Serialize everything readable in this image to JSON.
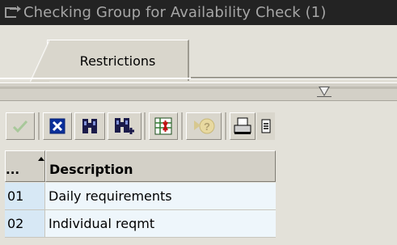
{
  "window": {
    "title": "Checking Group for Availability Check (1)"
  },
  "tabs": [
    {
      "label": "Restrictions",
      "active": true
    }
  ],
  "toolbar": {
    "buttons": [
      {
        "name": "check-icon",
        "enabled": false
      },
      {
        "name": "delete-icon",
        "enabled": true
      },
      {
        "name": "find-icon",
        "enabled": true
      },
      {
        "name": "find-next-icon",
        "enabled": true
      },
      {
        "name": "new-entries-icon",
        "enabled": true
      },
      {
        "name": "help-icon",
        "enabled": false
      },
      {
        "name": "print-icon",
        "enabled": true
      },
      {
        "name": "details-icon",
        "enabled": true
      }
    ]
  },
  "table": {
    "headers": {
      "select": "...",
      "description": "Description"
    },
    "rows": [
      {
        "key": "01",
        "description": "Daily requirements"
      },
      {
        "key": "02",
        "description": "Individual reqmt"
      }
    ]
  },
  "colors": {
    "titlebar": "#232323",
    "background": "#e3e1d9",
    "key_cell": "#d7e8f5",
    "desc_cell": "#eef6fb"
  }
}
